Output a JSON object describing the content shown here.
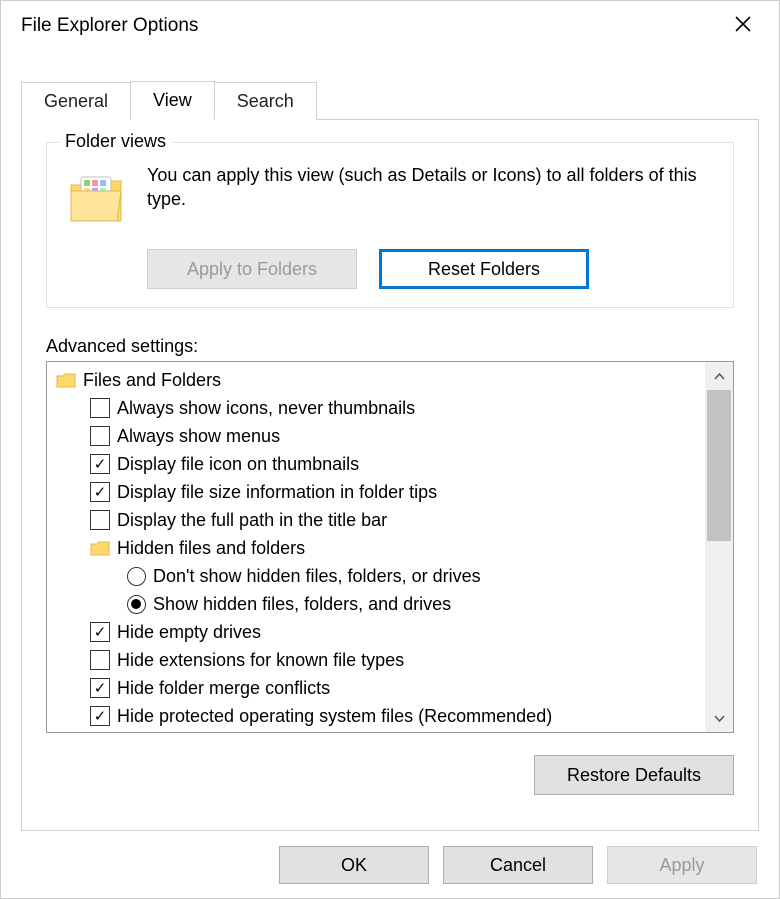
{
  "window": {
    "title": "File Explorer Options"
  },
  "tabs": {
    "general": "General",
    "view": "View",
    "search": "Search",
    "active": "view"
  },
  "folder_views": {
    "legend": "Folder views",
    "description": "You can apply this view (such as Details or Icons) to all folders of this type.",
    "apply_label": "Apply to Folders",
    "reset_label": "Reset Folders"
  },
  "advanced": {
    "label": "Advanced settings:",
    "root_label": "Files and Folders",
    "items": [
      {
        "type": "checkbox",
        "checked": false,
        "label": "Always show icons, never thumbnails"
      },
      {
        "type": "checkbox",
        "checked": false,
        "label": "Always show menus"
      },
      {
        "type": "checkbox",
        "checked": true,
        "label": "Display file icon on thumbnails"
      },
      {
        "type": "checkbox",
        "checked": true,
        "label": "Display file size information in folder tips"
      },
      {
        "type": "checkbox",
        "checked": false,
        "label": "Display the full path in the title bar"
      }
    ],
    "hidden_group_label": "Hidden files and folders",
    "hidden_radios": [
      {
        "selected": false,
        "label": "Don't show hidden files, folders, or drives"
      },
      {
        "selected": true,
        "label": "Show hidden files, folders, and drives"
      }
    ],
    "items2": [
      {
        "type": "checkbox",
        "checked": true,
        "label": "Hide empty drives"
      },
      {
        "type": "checkbox",
        "checked": false,
        "label": "Hide extensions for known file types"
      },
      {
        "type": "checkbox",
        "checked": true,
        "label": "Hide folder merge conflicts"
      },
      {
        "type": "checkbox",
        "checked": true,
        "label": "Hide protected operating system files (Recommended)"
      }
    ],
    "restore_label": "Restore Defaults"
  },
  "buttons": {
    "ok": "OK",
    "cancel": "Cancel",
    "apply": "Apply"
  }
}
